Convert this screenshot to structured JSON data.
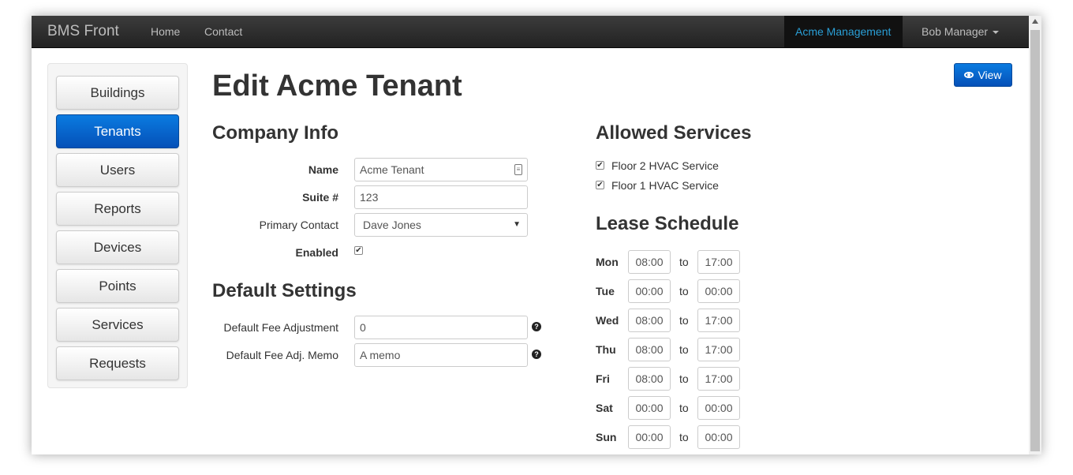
{
  "navbar": {
    "brand": "BMS Front",
    "links": [
      "Home",
      "Contact"
    ],
    "org": "Acme Management",
    "user": "Bob Manager"
  },
  "sidebar": {
    "items": [
      {
        "label": "Buildings",
        "active": false
      },
      {
        "label": "Tenants",
        "active": true
      },
      {
        "label": "Users",
        "active": false
      },
      {
        "label": "Reports",
        "active": false
      },
      {
        "label": "Devices",
        "active": false
      },
      {
        "label": "Points",
        "active": false
      },
      {
        "label": "Services",
        "active": false
      },
      {
        "label": "Requests",
        "active": false
      }
    ]
  },
  "page": {
    "title": "Edit Acme Tenant",
    "view_label": "View"
  },
  "company_info": {
    "heading": "Company Info",
    "name_label": "Name",
    "name_value": "Acme Tenant",
    "suite_label": "Suite #",
    "suite_value": "123",
    "contact_label": "Primary Contact",
    "contact_value": "Dave Jones",
    "enabled_label": "Enabled",
    "enabled": true
  },
  "default_settings": {
    "heading": "Default Settings",
    "fee_adj_label": "Default Fee Adjustment",
    "fee_adj_value": "0",
    "memo_label": "Default Fee Adj. Memo",
    "memo_value": "A memo"
  },
  "allowed_services": {
    "heading": "Allowed Services",
    "items": [
      {
        "label": "Floor 2 HVAC Service",
        "checked": true
      },
      {
        "label": "Floor 1 HVAC Service",
        "checked": true
      }
    ]
  },
  "lease_schedule": {
    "heading": "Lease Schedule",
    "to_label": "to",
    "days": [
      {
        "day": "Mon",
        "start": "08:00",
        "end": "17:00"
      },
      {
        "day": "Tue",
        "start": "00:00",
        "end": "00:00"
      },
      {
        "day": "Wed",
        "start": "08:00",
        "end": "17:00"
      },
      {
        "day": "Thu",
        "start": "08:00",
        "end": "17:00"
      },
      {
        "day": "Fri",
        "start": "08:00",
        "end": "17:00"
      },
      {
        "day": "Sat",
        "start": "00:00",
        "end": "00:00"
      },
      {
        "day": "Sun",
        "start": "00:00",
        "end": "00:00"
      }
    ]
  },
  "colors": {
    "primary": "#0a6ad6",
    "navbar_bg": "#222222",
    "link_accent": "#2a9fd6"
  }
}
